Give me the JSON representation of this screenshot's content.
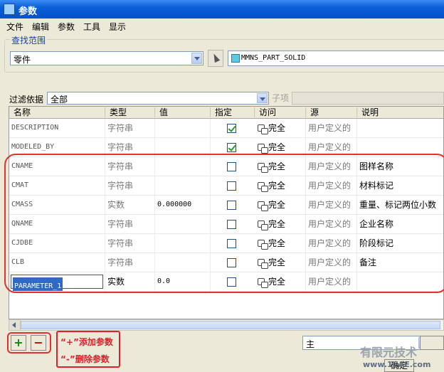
{
  "window": {
    "title": "参数"
  },
  "menu": [
    "文件",
    "编辑",
    "参数",
    "工具",
    "显示"
  ],
  "search_scope": {
    "group_label": "查找范围",
    "scope_value": "零件",
    "solid_name": "MMNS_PART_SOLID"
  },
  "filter": {
    "label": "过滤依据",
    "value": "全部",
    "sub_label": "子项"
  },
  "table": {
    "columns": [
      "名称",
      "类型",
      "值",
      "指定",
      "访问",
      "源",
      "说明"
    ],
    "rows": [
      {
        "name": "DESCRIPTION",
        "type": "字符串",
        "value": "",
        "designated": true,
        "access": "完全",
        "source": "用户定义的",
        "desc": ""
      },
      {
        "name": "MODELED_BY",
        "type": "字符串",
        "value": "",
        "designated": true,
        "access": "完全",
        "source": "用户定义的",
        "desc": ""
      },
      {
        "name": "CNAME",
        "type": "字符串",
        "value": "",
        "designated": false,
        "access": "完全",
        "source": "用户定义的",
        "desc": "图样名称"
      },
      {
        "name": "CMAT",
        "type": "字符串",
        "value": "",
        "designated": false,
        "access": "完全",
        "source": "用户定义的",
        "desc": "材料标记"
      },
      {
        "name": "CMASS",
        "type": "实数",
        "value": "0.000000",
        "designated": false,
        "access": "完全",
        "source": "用户定义的",
        "desc": "重量、标记两位小数"
      },
      {
        "name": "QNAME",
        "type": "字符串",
        "value": "",
        "designated": false,
        "access": "完全",
        "source": "用户定义的",
        "desc": "企业名称"
      },
      {
        "name": "CJDBE",
        "type": "字符串",
        "value": "",
        "designated": false,
        "access": "完全",
        "source": "用户定义的",
        "desc": "阶段标记"
      },
      {
        "name": "CLB",
        "type": "字符串",
        "value": "",
        "designated": false,
        "access": "完全",
        "source": "用户定义的",
        "desc": "备注"
      },
      {
        "name": "PARAMETER_1",
        "type": "实数",
        "value": "0.0",
        "designated": false,
        "access": "完全",
        "source": "用户定义的",
        "desc": ""
      }
    ]
  },
  "buttons": {
    "add": "+",
    "remove": "−",
    "ok": "确定"
  },
  "legend": {
    "add_note": "“+”添加参数",
    "remove_note": "“-”删除参数"
  },
  "bottom_combo": {
    "value": "主"
  },
  "watermark": {
    "line1": "有限元技术",
    "line2": "www.1CAE.com"
  }
}
